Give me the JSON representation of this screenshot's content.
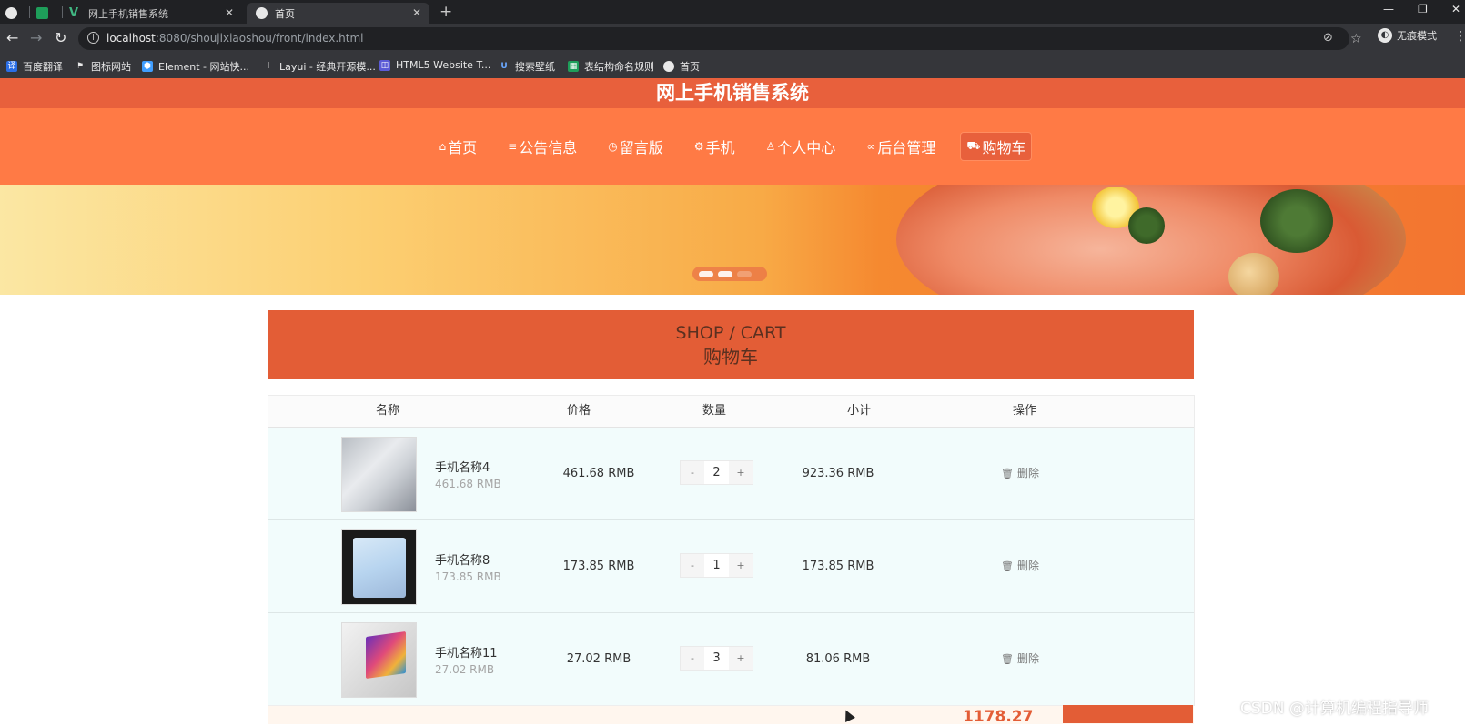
{
  "browser": {
    "tabs": [
      {
        "title": "",
        "icon": "globe-icon"
      },
      {
        "title": "",
        "icon": "sheet-icon"
      },
      {
        "title": "网上手机销售系统",
        "icon": "vue-icon"
      },
      {
        "title": "首页",
        "icon": "globe-icon"
      }
    ],
    "url_host": "localhost",
    "url_rest": ":8080/shoujixiaoshou/front/index.html",
    "profile_label": "无痕模式",
    "bookmarks": [
      "百度翻译",
      "图标网站",
      "Element - 网站快...",
      "Layui - 经典开源模...",
      "HTML5 Website T...",
      "搜索壁纸",
      "表结构命名规则",
      "首页"
    ]
  },
  "site": {
    "title": "网上手机销售系统",
    "nav": [
      "首页",
      "公告信息",
      "留言版",
      "手机",
      "个人中心",
      "后台管理",
      "购物车"
    ],
    "active_nav": "购物车"
  },
  "cart": {
    "heading_en": "SHOP / CART",
    "heading_zh": "购物车",
    "columns": [
      "名称",
      "价格",
      "数量",
      "小计",
      "操作"
    ],
    "items": [
      {
        "name": "手机名称4",
        "unit_price": "461.68 RMB",
        "price": "461.68 RMB",
        "qty": "2",
        "subtotal": "923.36 RMB",
        "action": "删除"
      },
      {
        "name": "手机名称8",
        "unit_price": "173.85 RMB",
        "price": "173.85 RMB",
        "qty": "1",
        "subtotal": "173.85 RMB",
        "action": "删除"
      },
      {
        "name": "手机名称11",
        "unit_price": "27.02 RMB",
        "price": "27.02 RMB",
        "qty": "3",
        "subtotal": "81.06 RMB",
        "action": "删除"
      }
    ],
    "stepper_minus": "-",
    "stepper_plus": "+",
    "total_partial": "1178.27"
  },
  "watermark": "CSDN @计算机编程指导师",
  "colors": {
    "header": "#ff7a45",
    "title_bar": "#e8603c",
    "cart_head": "#e35d36",
    "row_bg": "#f2fcfc"
  }
}
